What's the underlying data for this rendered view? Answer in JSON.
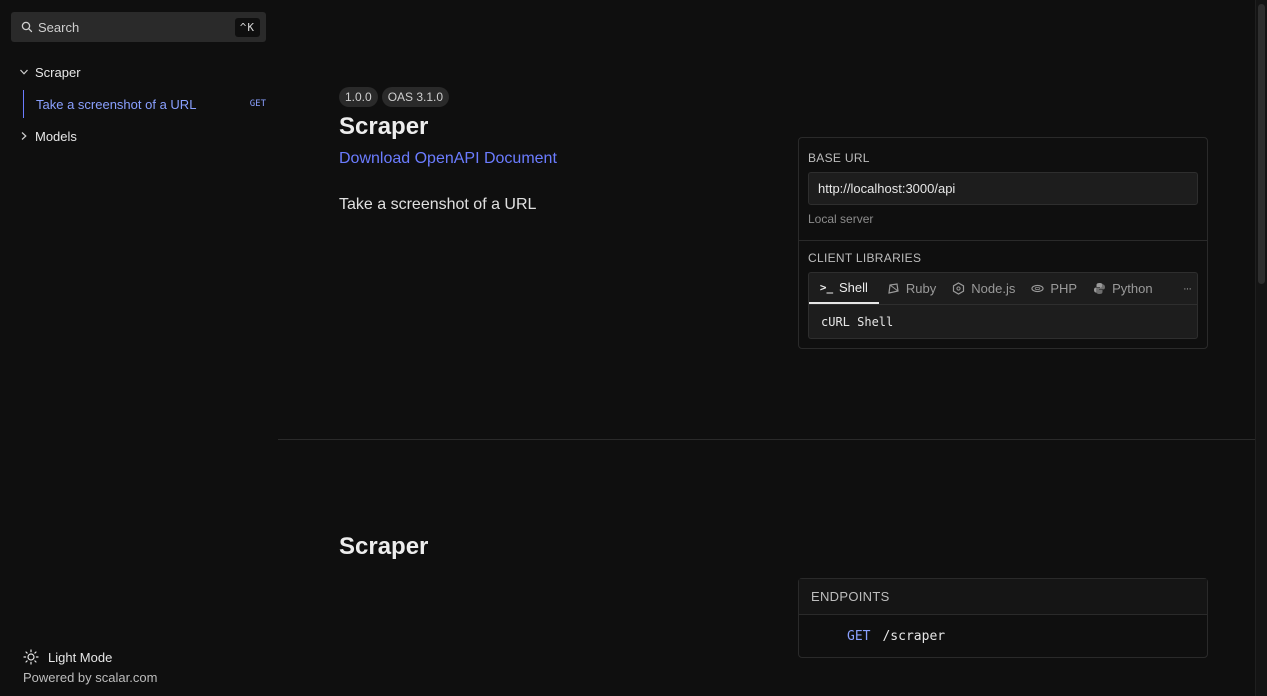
{
  "sidebar": {
    "search": {
      "label": "Search",
      "shortcut": "^K"
    },
    "items": [
      {
        "label": "Scraper",
        "expanded": true
      },
      {
        "label": "Take a screenshot of a URL",
        "method": "GET"
      },
      {
        "label": "Models",
        "expanded": false
      }
    ],
    "mode_toggle": "Light Mode",
    "powered_by": "Powered by scalar.com"
  },
  "header": {
    "badges": [
      "1.0.0",
      "OAS 3.1.0"
    ],
    "title": "Scraper",
    "download_link": "Download OpenAPI Document",
    "description": "Take a screenshot of a URL"
  },
  "config_card": {
    "base_url_heading": "BASE URL",
    "base_url_value": "http://localhost:3000/api",
    "server_description": "Local server",
    "client_libraries_heading": "CLIENT LIBRARIES",
    "tabs": [
      {
        "label": "Shell",
        "icon": "terminal-icon",
        "active": true
      },
      {
        "label": "Ruby",
        "icon": "ruby-icon",
        "active": false
      },
      {
        "label": "Node.js",
        "icon": "nodejs-icon",
        "active": false
      },
      {
        "label": "PHP",
        "icon": "php-icon",
        "active": false
      },
      {
        "label": "Python",
        "icon": "python-icon",
        "active": false
      }
    ],
    "more_label": "···",
    "code_sample": "cURL Shell"
  },
  "section": {
    "title": "Scraper",
    "endpoints_heading": "ENDPOINTS",
    "endpoints": [
      {
        "method": "GET",
        "path": "/scraper"
      }
    ]
  },
  "colors": {
    "accent": "#6b7cff",
    "background": "#0f0f0f"
  }
}
